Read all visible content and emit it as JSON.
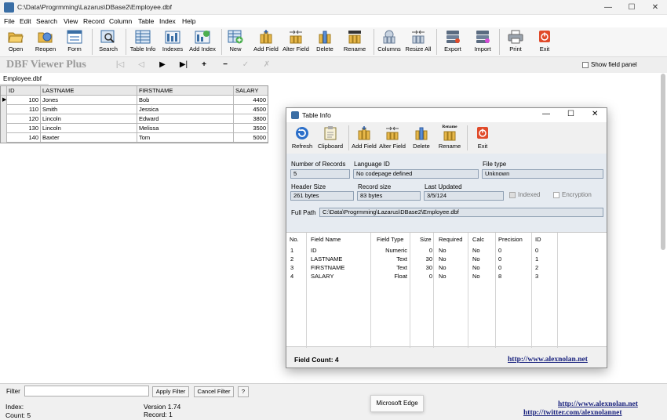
{
  "window": {
    "title": "C:\\Data\\Progrmming\\Lazarus\\DBase2\\Employee.dbf",
    "minimize": "—",
    "maximize": "☐",
    "close": "✕"
  },
  "menu": [
    "File",
    "Edit",
    "Search",
    "View",
    "Record",
    "Column",
    "Table",
    "Index",
    "Help"
  ],
  "toolbar": [
    "Open",
    "Reopen",
    "Form",
    "Search",
    "Table Info",
    "Indexes",
    "Add Index",
    "New",
    "Add Field",
    "Alter Field",
    "Delete",
    "Rename",
    "Columns",
    "Resize All",
    "Export",
    "Import",
    "Print",
    "Exit"
  ],
  "brand": "DBF Viewer Plus",
  "nav": {
    "first": "|◁",
    "prior": "◁",
    "next": "▶",
    "last": "▶|",
    "insert": "+",
    "delete": "−",
    "post": "✓",
    "cancel": "✗"
  },
  "show_field_panel": "Show field panel",
  "file_tab": "Employee.dbf",
  "grid": {
    "headers": [
      "ID",
      "LASTNAME",
      "FIRSTNAME",
      "SALARY"
    ],
    "rows": [
      [
        "100",
        "Jones",
        "Bob",
        "4400"
      ],
      [
        "110",
        "Smith",
        "Jessica",
        "4500"
      ],
      [
        "120",
        "Lincoln",
        "Edward",
        "3800"
      ],
      [
        "130",
        "Lincoln",
        "Melissa",
        "3500"
      ],
      [
        "140",
        "Baxter",
        "Tom",
        "5000"
      ]
    ]
  },
  "dialog": {
    "title": "Table Info",
    "toolbar": [
      "Refresh",
      "Clipboard",
      "Add Field",
      "Alter Field",
      "Delete",
      "Rename",
      "Exit"
    ],
    "rename_icon_text": "Rename",
    "labels": {
      "num_records": "Number of Records",
      "language_id": "Language ID",
      "file_type": "File type",
      "header_size": "Header Size",
      "record_size": "Record size",
      "last_updated": "Last Updated",
      "indexed": "Indexed",
      "encryption": "Encryption",
      "full_path": "Full Path"
    },
    "values": {
      "num_records": "5",
      "language_id": "No codepage defined",
      "file_type": "Unknown",
      "header_size": "261 bytes",
      "record_size": "83 bytes",
      "last_updated": "3/5/124",
      "full_path": "C:\\Data\\Progrmming\\Lazarus\\DBase2\\Employee.dbf"
    },
    "fields": {
      "headers": [
        "No.",
        "Field Name",
        "Field Type",
        "Size",
        "Required",
        "Calc",
        "Precision",
        "ID"
      ],
      "rows": [
        [
          "1",
          "ID",
          "Numeric",
          "0",
          "No",
          "No",
          "0",
          "0"
        ],
        [
          "2",
          "LASTNAME",
          "Text",
          "30",
          "No",
          "No",
          "0",
          "1"
        ],
        [
          "3",
          "FIRSTNAME",
          "Text",
          "30",
          "No",
          "No",
          "0",
          "2"
        ],
        [
          "4",
          "SALARY",
          "Float",
          "0",
          "No",
          "No",
          "8",
          "3"
        ]
      ]
    },
    "field_count": "Field Count: 4",
    "link": "http://www.alexnolan.net"
  },
  "filter": {
    "label": "Filter",
    "value": "",
    "apply": "Apply Filter",
    "cancel": "Cancel Filter",
    "help": "?"
  },
  "status": {
    "index": "Index:",
    "count": "Count: 5",
    "version": "Version 1.74",
    "record": "Record: 1",
    "tooltip": "Microsoft Edge",
    "link1": "http://www.alexnolan.net",
    "link2": "http://twitter.com/alexnolannet"
  },
  "colors": {
    "accent": "#3a6ea5",
    "link": "#1a237e",
    "field_box": "#dde3ea",
    "exit_red": "#e04a2a"
  }
}
